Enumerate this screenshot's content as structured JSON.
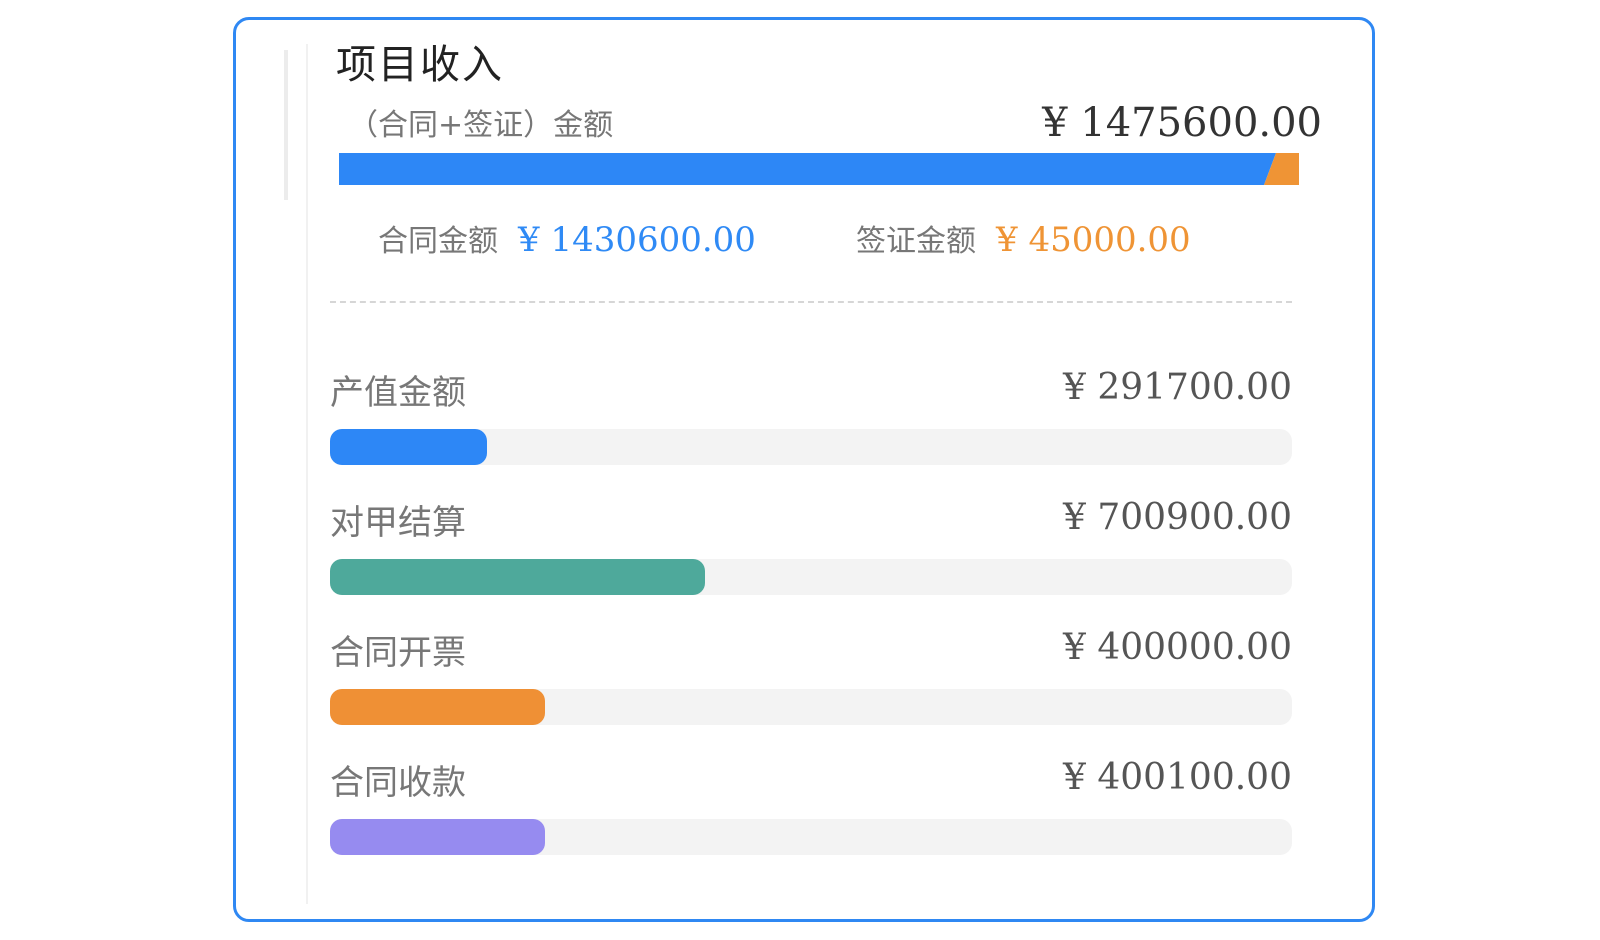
{
  "card": {
    "title": "项目收入",
    "total": {
      "label": "（合同+签证）金额",
      "amount": "¥ 1475600.00",
      "value": 1475600,
      "stack": [
        {
          "name": "合同金额",
          "value": 1430600,
          "color": "#2d87f6"
        },
        {
          "name": "签证金额",
          "value": 45000,
          "color": "#ef9435"
        }
      ]
    },
    "contract": {
      "label": "合同金额",
      "amount": "¥ 1430600.00",
      "color": "#2f8af5"
    },
    "visa": {
      "label": "签证金额",
      "amount": "¥ 45000.00",
      "color": "#ef9435"
    },
    "metrics": [
      {
        "label": "产值金额",
        "amount": "¥ 291700.00",
        "progress": 0.163,
        "color": "#2d87f6"
      },
      {
        "label": "对甲结算",
        "amount": "¥ 700900.00",
        "progress": 0.39,
        "color": "#4ea99b"
      },
      {
        "label": "合同开票",
        "amount": "¥ 400000.00",
        "progress": 0.223,
        "color": "#ef9035"
      },
      {
        "label": "合同收款",
        "amount": "¥ 400100.00",
        "progress": 0.223,
        "color": "#968bf0"
      }
    ]
  }
}
